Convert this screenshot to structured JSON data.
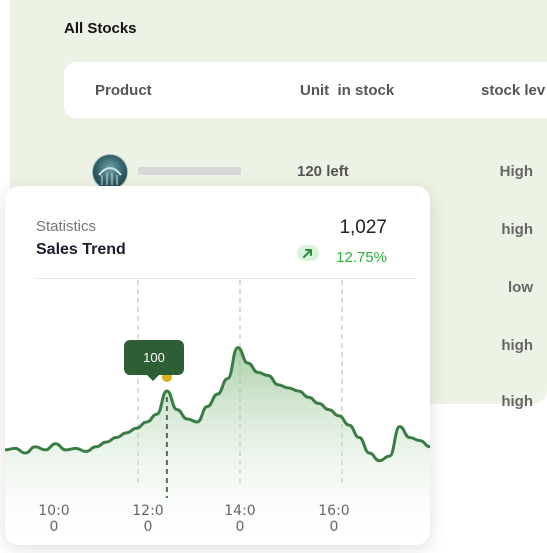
{
  "stocks": {
    "title": "All Stocks",
    "columns": [
      "Product",
      "Unit  in stock",
      "stock lev"
    ],
    "rows": [
      {
        "stock": "120 left",
        "level": "High"
      },
      {
        "stock": "",
        "level": "high"
      },
      {
        "stock": "",
        "level": "low"
      },
      {
        "stock": "",
        "level": "high"
      },
      {
        "stock": "",
        "level": "high"
      }
    ]
  },
  "stats": {
    "label": "Statistics",
    "title": "Sales Trend",
    "value": "1,027",
    "change": "12.75%",
    "trend_icon": "arrow-up-right-icon",
    "tooltip_value": "100",
    "colors": {
      "line": "#3a7d44",
      "fill": "#a8cfa4",
      "marker": "#d9b11a",
      "tooltip": "#2e5e33",
      "positive": "#2bb13a"
    }
  },
  "chart_data": {
    "type": "area",
    "x_ticks": [
      {
        "l1": "10:0",
        "l2": "0"
      },
      {
        "l1": "12:0",
        "l2": "0"
      },
      {
        "l1": "14:0",
        "l2": "0"
      },
      {
        "l1": "16:0",
        "l2": "0"
      }
    ],
    "highlight": {
      "x": "12:00",
      "value": 100
    },
    "values": [
      62,
      63,
      60,
      64,
      62,
      66,
      62,
      63,
      61,
      64,
      67,
      70,
      73,
      76,
      80,
      85,
      100,
      88,
      82,
      80,
      90,
      98,
      108,
      128,
      118,
      112,
      110,
      104,
      102,
      100,
      96,
      92,
      88,
      84,
      78,
      70,
      60,
      55,
      58,
      77,
      70,
      68,
      64
    ]
  }
}
